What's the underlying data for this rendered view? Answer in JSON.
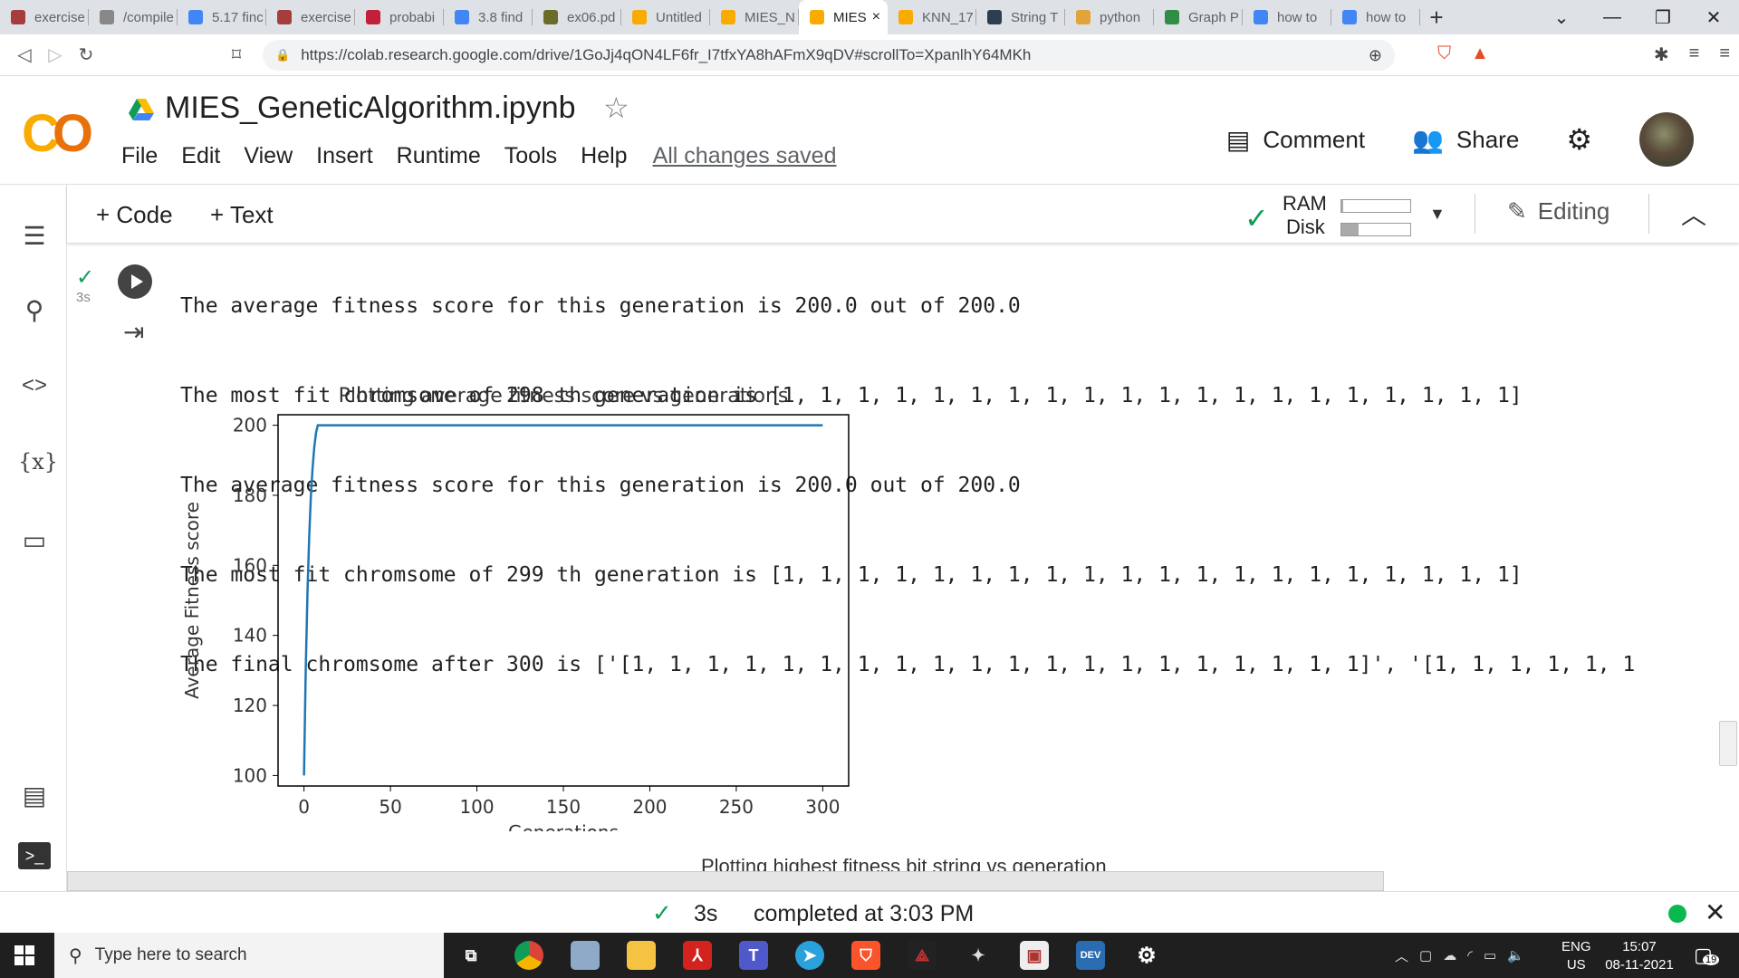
{
  "browser": {
    "tabs": [
      {
        "label": "exercise",
        "icon_color": "#a63d3d"
      },
      {
        "label": "/compile",
        "icon_color": "#888888"
      },
      {
        "label": "5.17 finc",
        "icon_color": "#4285f4"
      },
      {
        "label": "exercise",
        "icon_color": "#a63d3d"
      },
      {
        "label": "probabi",
        "icon_color": "#c21f3a"
      },
      {
        "label": "3.8 find",
        "icon_color": "#4285f4"
      },
      {
        "label": "ex06.pd",
        "icon_color": "#6b6b2a"
      },
      {
        "label": "Untitled",
        "icon_color": "#f9ab00"
      },
      {
        "label": "MIES_N",
        "icon_color": "#f9ab00"
      },
      {
        "label": "MIES",
        "icon_color": "#f9ab00"
      },
      {
        "label": "KNN_17",
        "icon_color": "#f9ab00"
      },
      {
        "label": "String T",
        "icon_color": "#2c3e50"
      },
      {
        "label": "python",
        "icon_color": "#e3a33b"
      },
      {
        "label": "Graph P",
        "icon_color": "#2f8d46"
      },
      {
        "label": "how to",
        "icon_color": "#4285f4"
      },
      {
        "label": "how to",
        "icon_color": "#4285f4"
      }
    ],
    "active_tab_index": 9,
    "tab_close": "×",
    "new_tab": "+",
    "url": "https://colab.research.google.com/drive/1GoJj4qON4LF6fr_I7tfxYA8hAFmX9qDV#scrollTo=XpanlhY64MKh"
  },
  "colab": {
    "notebook_title": "MIES_GeneticAlgorithm.ipynb",
    "menu": [
      "File",
      "Edit",
      "View",
      "Insert",
      "Runtime",
      "Tools",
      "Help"
    ],
    "save_status": "All changes saved",
    "comment_label": "Comment",
    "share_label": "Share",
    "add_code_label": "+ Code",
    "add_text_label": "+ Text",
    "ram_label": "RAM",
    "disk_label": "Disk",
    "ram_fraction": 0.03,
    "disk_fraction": 0.25,
    "editing_label": "Editing"
  },
  "cell": {
    "exec_time": "3s",
    "output_lines": [
      "The average fitness score for this generation is 200.0 out of 200.0",
      "The most fit chromsome of 298 th generation is [1, 1, 1, 1, 1, 1, 1, 1, 1, 1, 1, 1, 1, 1, 1, 1, 1, 1, 1, 1]",
      "The average fitness score for this generation is 200.0 out of 200.0",
      "The most fit chromsome of 299 th generation is [1, 1, 1, 1, 1, 1, 1, 1, 1, 1, 1, 1, 1, 1, 1, 1, 1, 1, 1, 1]",
      "The final chromsome after 300 is ['[1, 1, 1, 1, 1, 1, 1, 1, 1, 1, 1, 1, 1, 1, 1, 1, 1, 1, 1, 1]', '[1, 1, 1, 1, 1, 1"
    ],
    "next_chart_title": "Plotting highest fitness bit string vs generation"
  },
  "chart_data": {
    "type": "line",
    "title": "Plotting average fitness score vs generations",
    "xlabel": "Generations",
    "ylabel": "Average Fitness score",
    "xlim": [
      -15,
      315
    ],
    "ylim": [
      97,
      203
    ],
    "xticks": [
      0,
      50,
      100,
      150,
      200,
      250,
      300
    ],
    "yticks": [
      100,
      120,
      140,
      160,
      180,
      200
    ],
    "grid": false,
    "series": [
      {
        "color": "#1f77b4",
        "x": [
          0,
          1,
          2,
          3,
          4,
          5,
          6,
          7,
          8,
          300
        ],
        "y": [
          100,
          130,
          152,
          168,
          180,
          188,
          194,
          198,
          200,
          200
        ]
      }
    ]
  },
  "status": {
    "time": "3s",
    "completed": "completed at 3:03 PM"
  },
  "taskbar": {
    "search_placeholder": "Type here to search",
    "lang": "ENG",
    "region": "US",
    "time": "15:07",
    "date": "08-11-2021",
    "notification_count": "19"
  }
}
